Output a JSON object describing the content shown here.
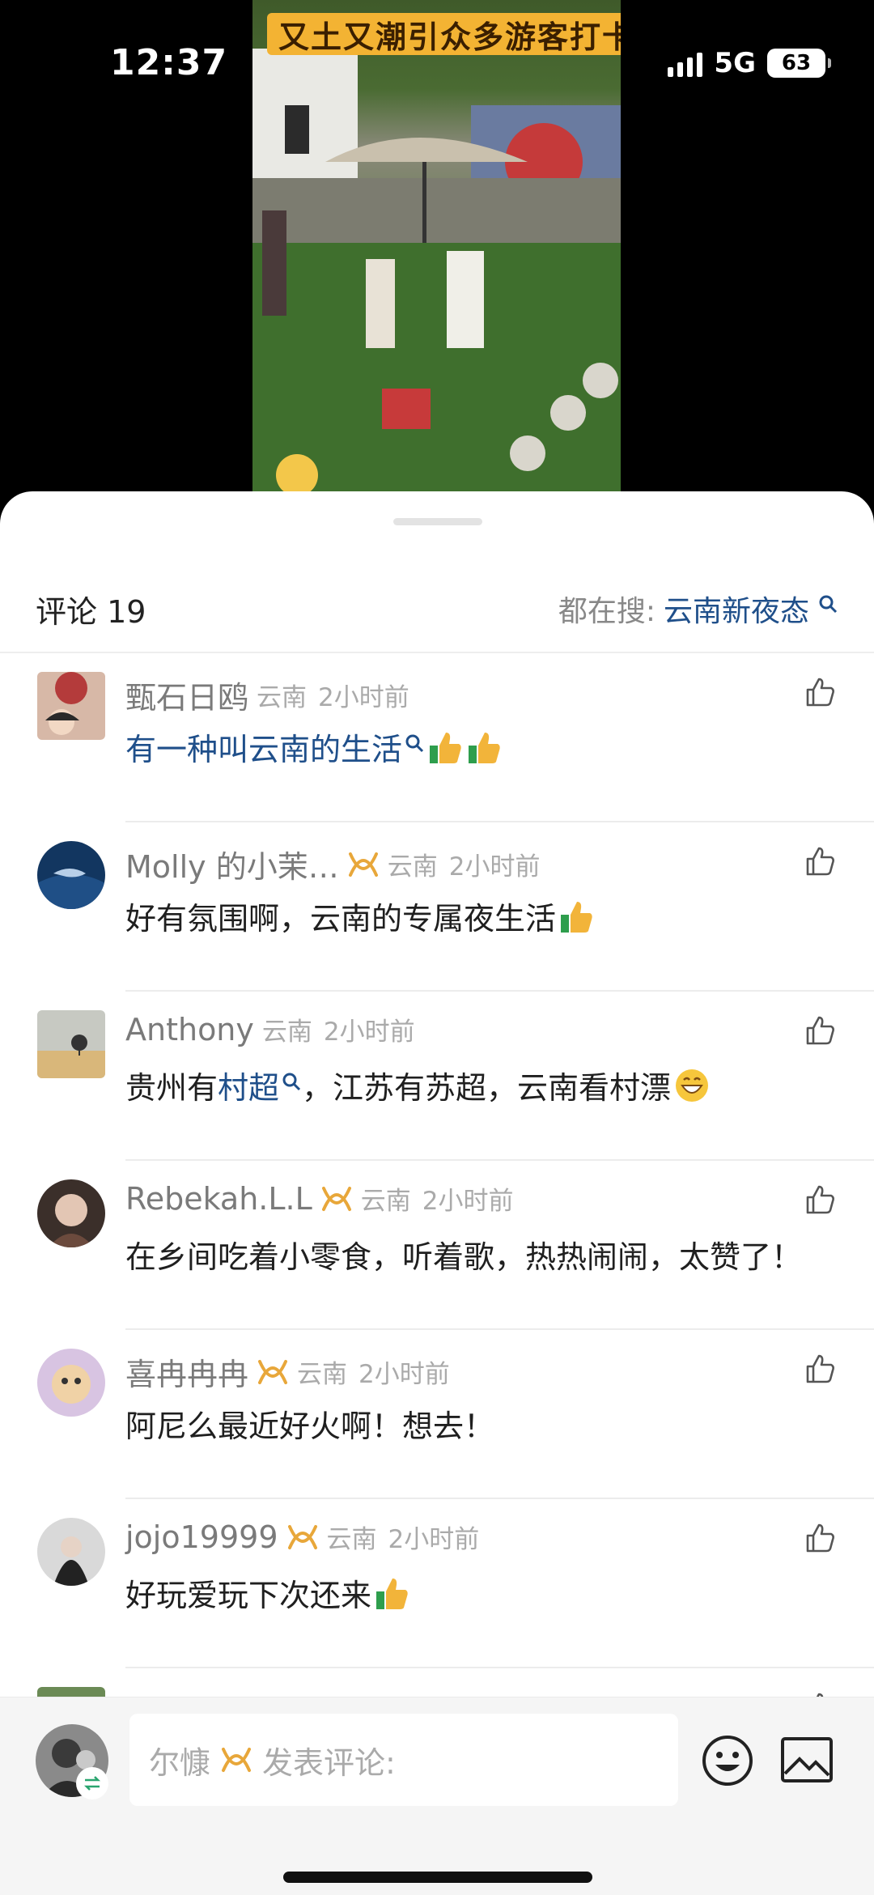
{
  "status_bar": {
    "time": "12:37",
    "network": "5G",
    "battery": "63"
  },
  "video": {
    "title": "又土又潮引众多游客打卡"
  },
  "header": {
    "comment_label": "评论 19",
    "hot_search_prefix": "都在搜:",
    "hot_search_term": "云南新夜态"
  },
  "comments": [
    {
      "username": "甄石日鸥",
      "badge": false,
      "location": "云南",
      "time": "2小时前",
      "parts": [
        {
          "text": "有一种叫云南的生活",
          "link": true,
          "search": true
        },
        {
          "emoji": "thumbs-up-emoji"
        },
        {
          "emoji": "thumbs-up-emoji"
        }
      ]
    },
    {
      "username": "Molly 的小茉…",
      "badge": true,
      "location": "云南",
      "time": "2小时前",
      "parts": [
        {
          "text": "好有氛围啊，云南的专属夜生活"
        },
        {
          "emoji": "thumbs-up-emoji"
        }
      ]
    },
    {
      "username": "Anthony",
      "badge": false,
      "location": "云南",
      "time": "2小时前",
      "parts": [
        {
          "text": "贵州有"
        },
        {
          "text": "村超",
          "link": true,
          "search": true
        },
        {
          "text": "，江苏有苏超，云南看村漂"
        },
        {
          "emoji": "grin-emoji"
        }
      ]
    },
    {
      "username": "Rebekah.L.L",
      "badge": true,
      "location": "云南",
      "time": "2小时前",
      "parts": [
        {
          "text": "在乡间吃着小零食，听着歌，热热闹闹，太赞了！"
        }
      ]
    },
    {
      "username": "喜冉冉冉",
      "badge": true,
      "location": "云南",
      "time": "2小时前",
      "parts": [
        {
          "text": "阿尼么最近好火啊！想去！"
        }
      ]
    },
    {
      "username": "jojo19999",
      "badge": true,
      "location": "云南",
      "time": "2小时前",
      "parts": [
        {
          "text": "好玩爱玩下次还来"
        },
        {
          "emoji": "thumbs-up-emoji"
        }
      ]
    },
    {
      "username": "",
      "badge": false,
      "location": "",
      "time": "",
      "parts": []
    }
  ],
  "input_bar": {
    "user_name": "尔慷",
    "placeholder": "发表评论:"
  },
  "colors": {
    "link": "#1f4f8a",
    "badge": "#e8a73a",
    "muted": "#aaaaaa"
  }
}
